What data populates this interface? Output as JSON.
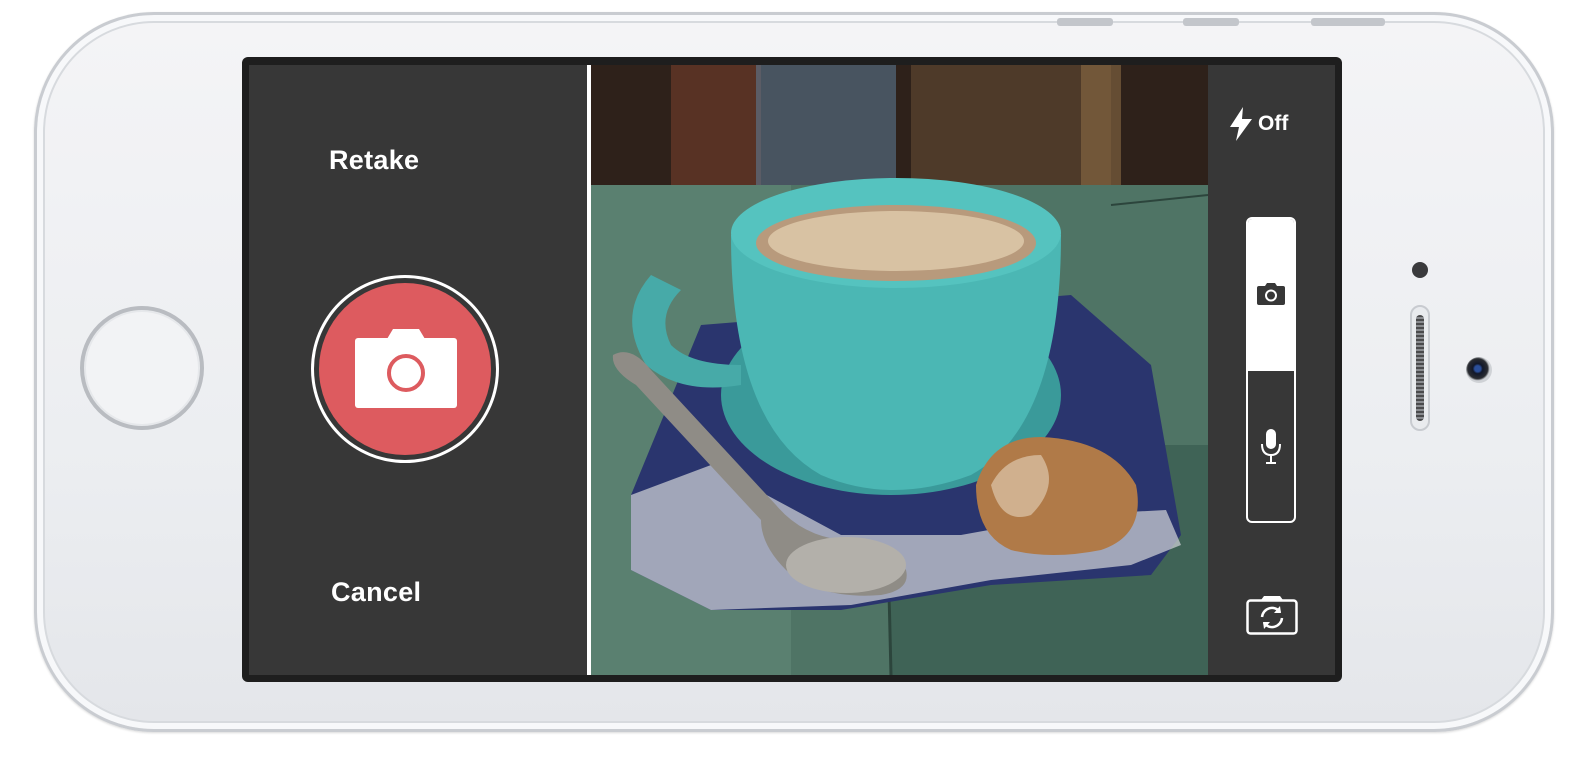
{
  "left_panel": {
    "retake_label": "Retake",
    "cancel_label": "Cancel",
    "shutter_icon": "camera-icon"
  },
  "right_panel": {
    "flash_icon": "lightning-bolt-icon",
    "flash_label": "Off",
    "mode_toggle": {
      "selected": "photo",
      "photo_icon": "camera-icon",
      "audio_icon": "microphone-icon"
    },
    "switch_camera_icon": "camera-switch-icon"
  },
  "viewfinder": {
    "subject": "viewfinder-image"
  },
  "colors": {
    "shutter_red": "#dd5b5f",
    "panel_dark": "#373737",
    "text_white": "#ffffff"
  }
}
